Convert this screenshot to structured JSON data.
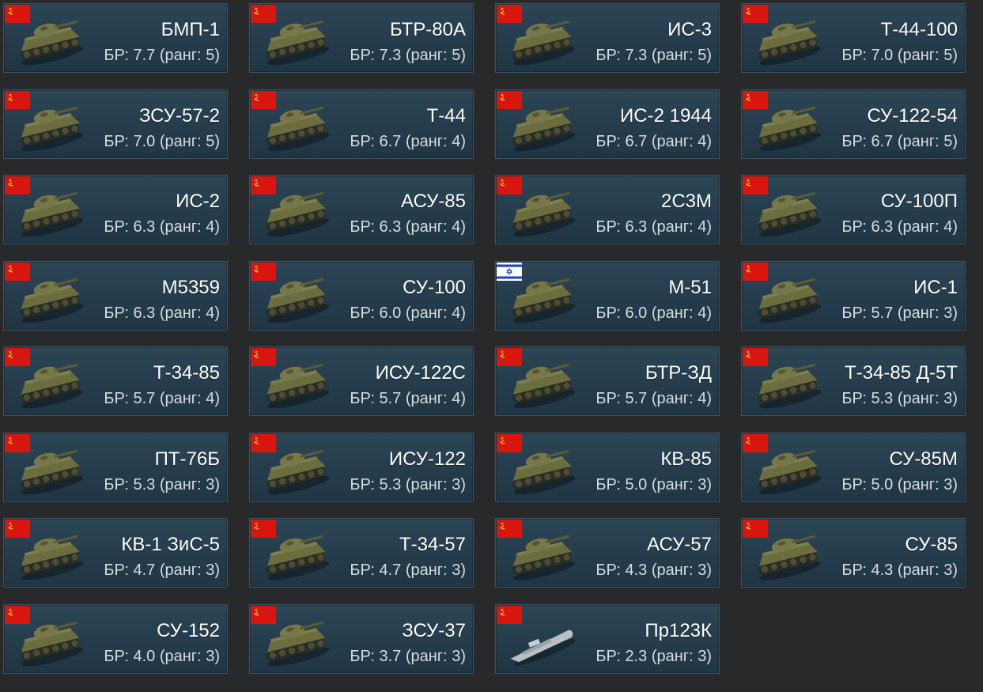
{
  "cards": [
    {
      "name": "БМП-1",
      "br": "БР: 7.7 (ранг: 5)",
      "flag": "ussr-flag-icon",
      "vehicle": "tank-icon"
    },
    {
      "name": "БТР-80А",
      "br": "БР: 7.3 (ранг: 5)",
      "flag": "ussr-flag-icon",
      "vehicle": "tank-icon"
    },
    {
      "name": "ИС-3",
      "br": "БР: 7.3 (ранг: 5)",
      "flag": "ussr-flag-icon",
      "vehicle": "tank-icon"
    },
    {
      "name": "Т-44-100",
      "br": "БР: 7.0 (ранг: 5)",
      "flag": "ussr-flag-icon",
      "vehicle": "tank-icon"
    },
    {
      "name": "ЗСУ-57-2",
      "br": "БР: 7.0 (ранг: 5)",
      "flag": "ussr-flag-icon",
      "vehicle": "tank-icon"
    },
    {
      "name": "Т-44",
      "br": "БР: 6.7 (ранг: 4)",
      "flag": "ussr-flag-icon",
      "vehicle": "tank-icon"
    },
    {
      "name": "ИС-2 1944",
      "br": "БР: 6.7 (ранг: 4)",
      "flag": "ussr-flag-icon",
      "vehicle": "tank-icon"
    },
    {
      "name": "СУ-122-54",
      "br": "БР: 6.7 (ранг: 5)",
      "flag": "ussr-flag-icon",
      "vehicle": "tank-icon"
    },
    {
      "name": "ИС-2",
      "br": "БР: 6.3 (ранг: 4)",
      "flag": "ussr-flag-icon",
      "vehicle": "tank-icon"
    },
    {
      "name": "АСУ-85",
      "br": "БР: 6.3 (ранг: 4)",
      "flag": "ussr-flag-icon",
      "vehicle": "tank-icon"
    },
    {
      "name": "2С3М",
      "br": "БР: 6.3 (ранг: 4)",
      "flag": "ussr-flag-icon",
      "vehicle": "tank-icon"
    },
    {
      "name": "СУ-100П",
      "br": "БР: 6.3 (ранг: 4)",
      "flag": "ussr-flag-icon",
      "vehicle": "tank-icon"
    },
    {
      "name": "M5359",
      "br": "БР: 6.3 (ранг: 4)",
      "flag": "ussr-flag-icon",
      "vehicle": "tank-icon"
    },
    {
      "name": "СУ-100",
      "br": "БР: 6.0 (ранг: 4)",
      "flag": "ussr-flag-icon",
      "vehicle": "tank-icon"
    },
    {
      "name": "M-51",
      "br": "БР: 6.0 (ранг: 4)",
      "flag": "israel-flag-icon",
      "vehicle": "tank-icon"
    },
    {
      "name": "ИС-1",
      "br": "БР: 5.7 (ранг: 3)",
      "flag": "ussr-flag-icon",
      "vehicle": "tank-icon"
    },
    {
      "name": "Т-34-85",
      "br": "БР: 5.7 (ранг: 4)",
      "flag": "ussr-flag-icon",
      "vehicle": "tank-icon"
    },
    {
      "name": "ИСУ-122С",
      "br": "БР: 5.7 (ранг: 4)",
      "flag": "ussr-flag-icon",
      "vehicle": "tank-icon"
    },
    {
      "name": "БТР-ЗД",
      "br": "БР: 5.7 (ранг: 4)",
      "flag": "ussr-flag-icon",
      "vehicle": "tank-icon"
    },
    {
      "name": "Т-34-85 Д-5Т",
      "br": "БР: 5.3 (ранг: 3)",
      "flag": "ussr-flag-icon",
      "vehicle": "tank-icon"
    },
    {
      "name": "ПТ-76Б",
      "br": "БР: 5.3 (ранг: 3)",
      "flag": "ussr-flag-icon",
      "vehicle": "tank-icon"
    },
    {
      "name": "ИСУ-122",
      "br": "БР: 5.3 (ранг: 3)",
      "flag": "ussr-flag-icon",
      "vehicle": "tank-icon"
    },
    {
      "name": "КВ-85",
      "br": "БР: 5.0 (ранг: 3)",
      "flag": "ussr-flag-icon",
      "vehicle": "tank-icon"
    },
    {
      "name": "СУ-85М",
      "br": "БР: 5.0 (ранг: 3)",
      "flag": "ussr-flag-icon",
      "vehicle": "tank-icon"
    },
    {
      "name": "КВ-1 ЗиС-5",
      "br": "БР: 4.7 (ранг: 3)",
      "flag": "ussr-flag-icon",
      "vehicle": "tank-icon"
    },
    {
      "name": "Т-34-57",
      "br": "БР: 4.7 (ранг: 3)",
      "flag": "ussr-flag-icon",
      "vehicle": "tank-icon"
    },
    {
      "name": "АСУ-57",
      "br": "БР: 4.3 (ранг: 3)",
      "flag": "ussr-flag-icon",
      "vehicle": "tank-icon"
    },
    {
      "name": "СУ-85",
      "br": "БР: 4.3 (ранг: 3)",
      "flag": "ussr-flag-icon",
      "vehicle": "tank-icon"
    },
    {
      "name": "СУ-152",
      "br": "БР: 4.0 (ранг: 3)",
      "flag": "ussr-flag-icon",
      "vehicle": "tank-icon"
    },
    {
      "name": "ЗСУ-37",
      "br": "БР: 3.7 (ранг: 3)",
      "flag": "ussr-flag-icon",
      "vehicle": "tank-icon"
    },
    {
      "name": "Пр123К",
      "br": "БР: 2.3 (ранг: 3)",
      "flag": "ussr-flag-icon",
      "vehicle": "boat-icon"
    }
  ],
  "colors": {
    "page_background": "#28292b",
    "card_background": "#2a4353",
    "card_border": "#3c5566",
    "name_text": "#ffffff",
    "br_text": "#d6dde2",
    "ussr_flag_red": "#d9150f",
    "ussr_emblem_yellow": "#f5d13a",
    "israel_flag_blue": "#1d3ec7",
    "vehicle_olive": "#6c6d3e",
    "boat_grey": "#b8c0c4"
  }
}
